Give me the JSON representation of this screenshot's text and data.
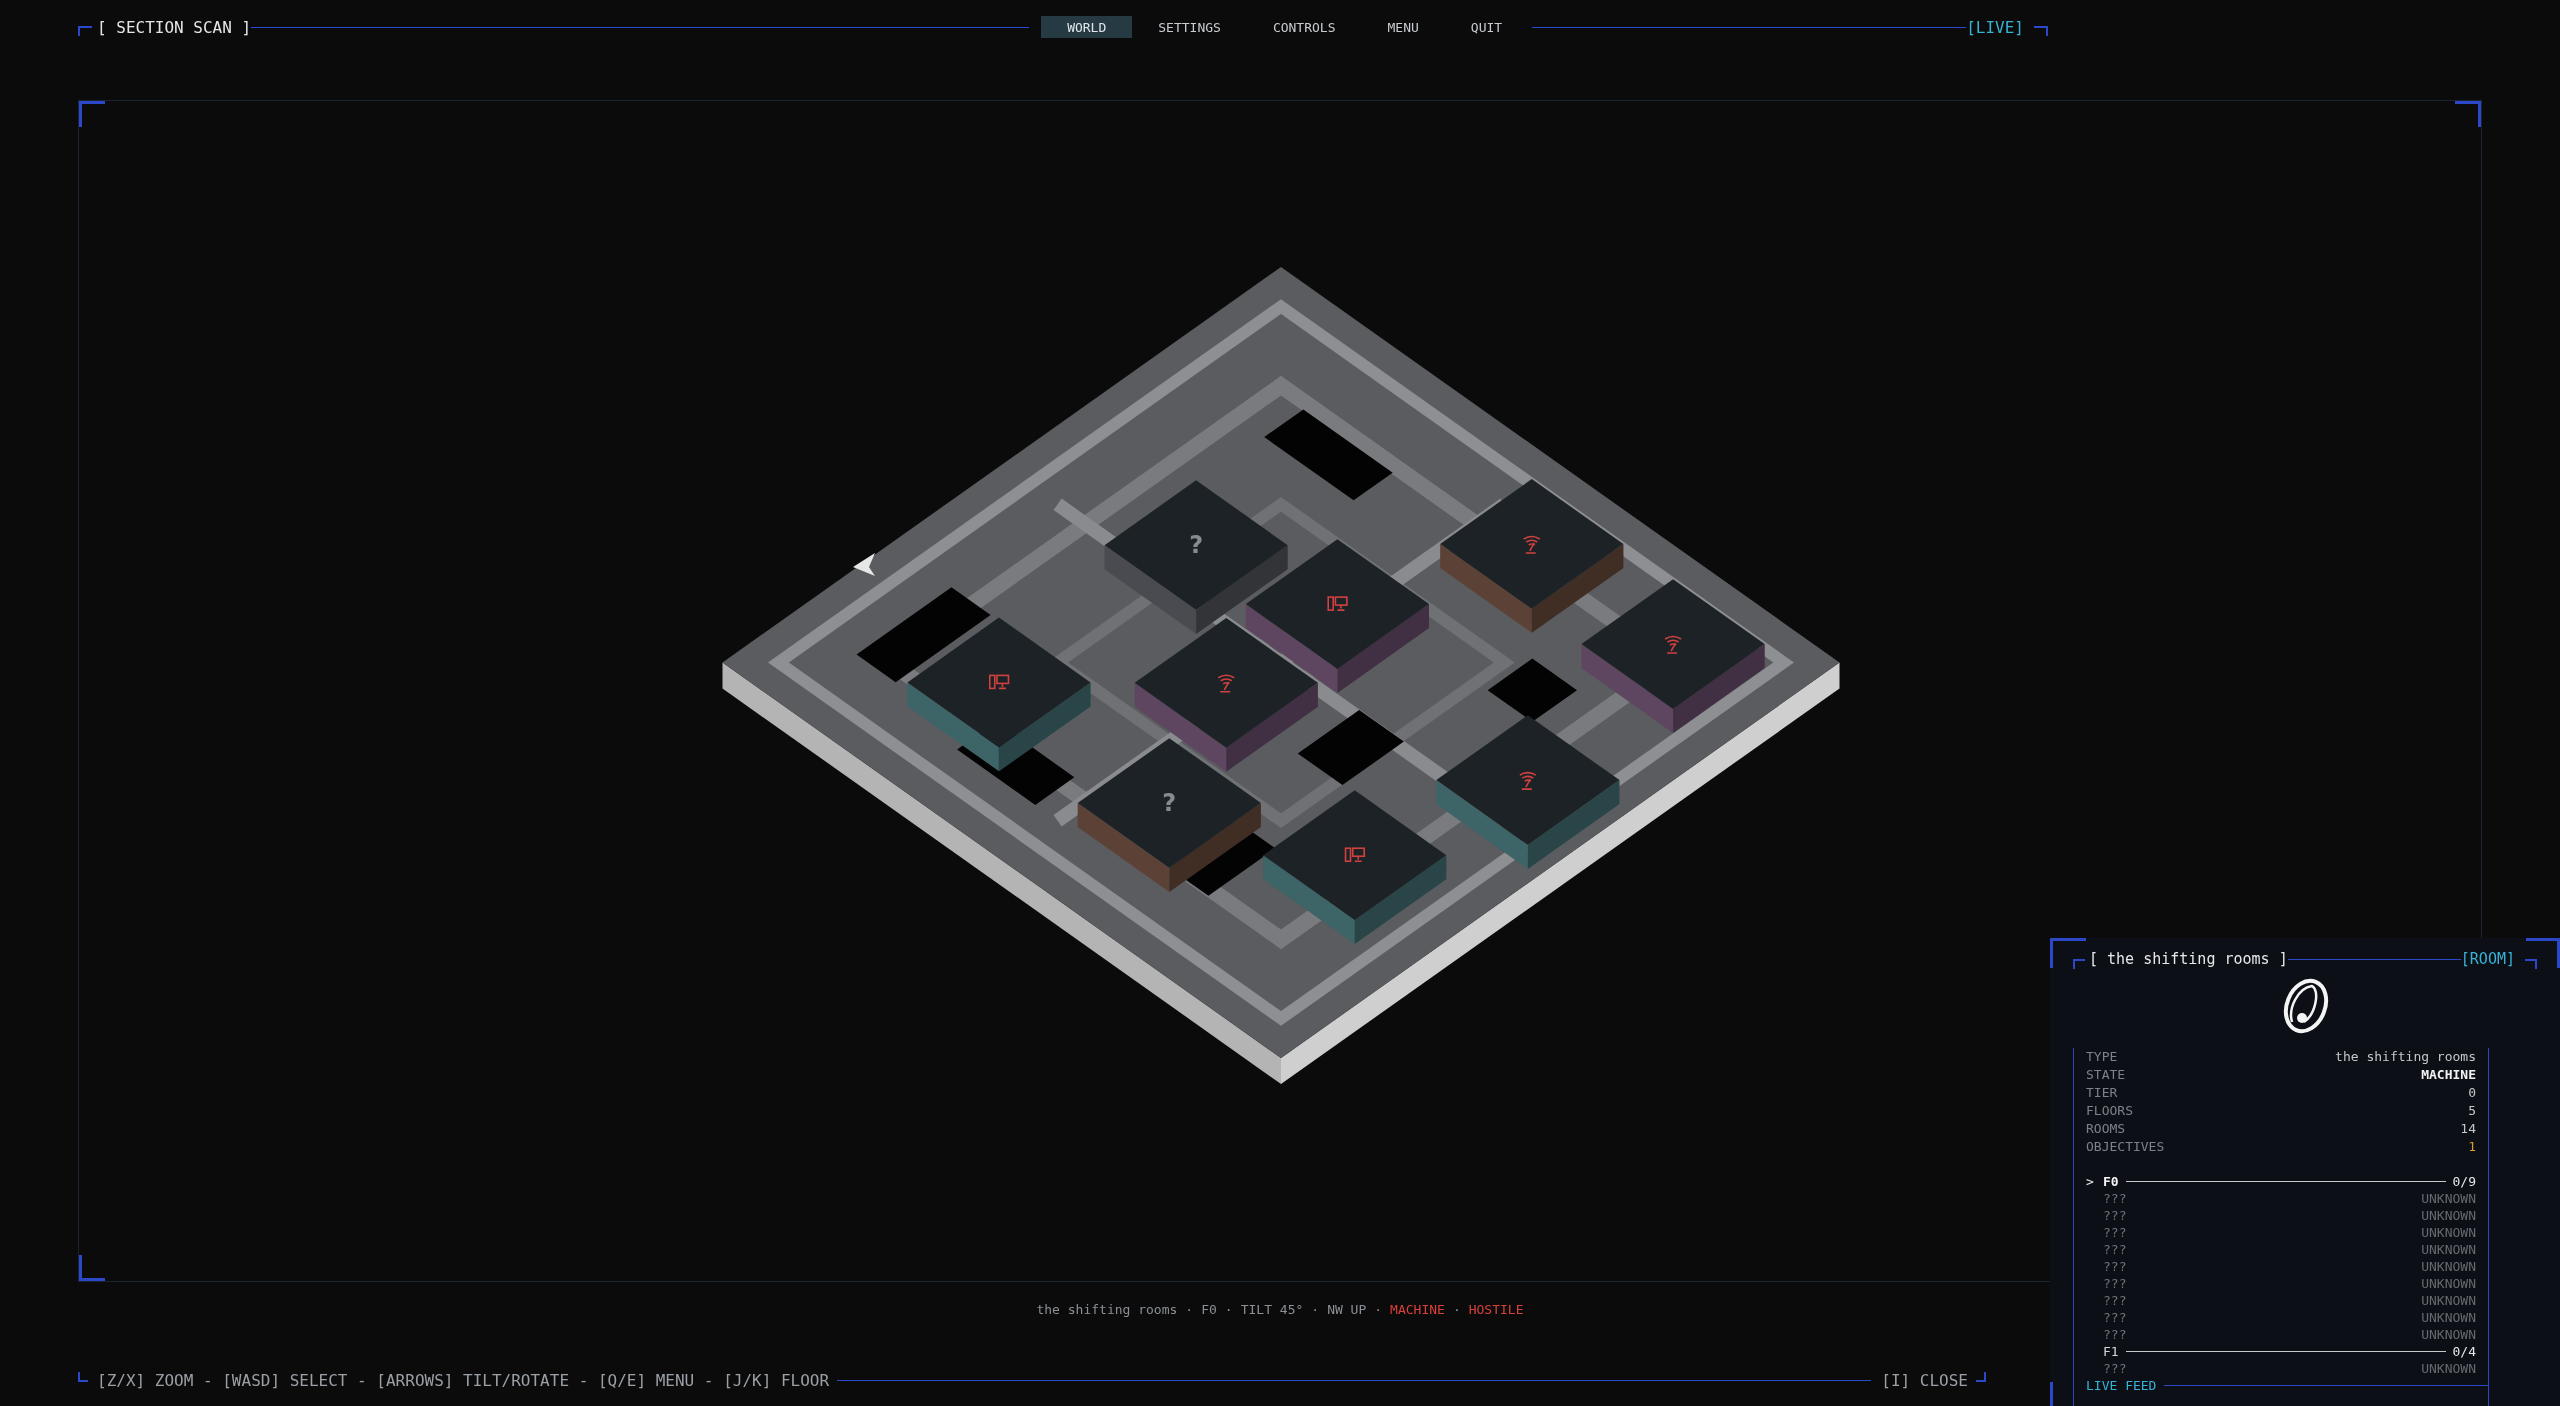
{
  "header": {
    "title": "[ SECTION SCAN ]",
    "status": "[LIVE]",
    "tabs": [
      {
        "label": "WORLD",
        "selected": true
      },
      {
        "label": "SETTINGS",
        "selected": false
      },
      {
        "label": "CONTROLS",
        "selected": false
      },
      {
        "label": "MENU",
        "selected": false
      },
      {
        "label": "QUIT",
        "selected": false
      }
    ]
  },
  "map": {
    "rooms": [
      {
        "kind": "unknown",
        "label": "?",
        "color": "#4a4b50"
      },
      {
        "kind": "computer",
        "color": "#5e4560"
      },
      {
        "kind": "antenna",
        "color": "#5c4236"
      },
      {
        "kind": "antenna",
        "color": "#5e4560"
      },
      {
        "kind": "computer",
        "color": "#3d6466"
      },
      {
        "kind": "antenna",
        "color": "#5e4560"
      },
      {
        "kind": "unknown",
        "label": "?",
        "color": "#5c4236"
      },
      {
        "kind": "antenna",
        "color": "#3d6466"
      },
      {
        "kind": "computer",
        "color": "#3d6466"
      }
    ]
  },
  "status_line": {
    "separator": "·",
    "items": [
      {
        "text": "the shifting rooms",
        "alert": false
      },
      {
        "text": "F0",
        "alert": false
      },
      {
        "text": "TILT 45°",
        "alert": false
      },
      {
        "text": "NW UP",
        "alert": false
      },
      {
        "text": "MACHINE",
        "alert": true
      },
      {
        "text": "HOSTILE",
        "alert": true
      }
    ]
  },
  "hints": {
    "keys": "[Z/X] ZOOM - [WASD] SELECT - [ARROWS] TILT/ROTATE - [Q/E] MENU - [J/K] FLOOR",
    "close": "[I] CLOSE"
  },
  "room_panel": {
    "title": "[ the shifting rooms ]",
    "tag": "[ROOM]",
    "marker": ">",
    "feed_label": "LIVE FEED",
    "stats": [
      {
        "label": "TYPE",
        "value": "the shifting rooms",
        "kind": "plain"
      },
      {
        "label": "STATE",
        "value": "MACHINE",
        "kind": "strong"
      },
      {
        "label": "TIER",
        "value": "0",
        "kind": "plain"
      },
      {
        "label": "FLOORS",
        "value": "5",
        "kind": "plain"
      },
      {
        "label": "ROOMS",
        "value": "14",
        "kind": "plain"
      },
      {
        "label": "OBJECTIVES",
        "value": "1",
        "kind": "highlight"
      }
    ],
    "floors": [
      {
        "label": "F0",
        "count": "0/9",
        "selected": true,
        "rooms": [
          {
            "name": "???",
            "status": "UNKNOWN"
          },
          {
            "name": "???",
            "status": "UNKNOWN"
          },
          {
            "name": "???",
            "status": "UNKNOWN"
          },
          {
            "name": "???",
            "status": "UNKNOWN"
          },
          {
            "name": "???",
            "status": "UNKNOWN"
          },
          {
            "name": "???",
            "status": "UNKNOWN"
          },
          {
            "name": "???",
            "status": "UNKNOWN"
          },
          {
            "name": "???",
            "status": "UNKNOWN"
          },
          {
            "name": "???",
            "status": "UNKNOWN"
          }
        ]
      },
      {
        "label": "F1",
        "count": "0/4",
        "selected": false,
        "rooms": [
          {
            "name": "???",
            "status": "UNKNOWN"
          }
        ]
      }
    ]
  }
}
